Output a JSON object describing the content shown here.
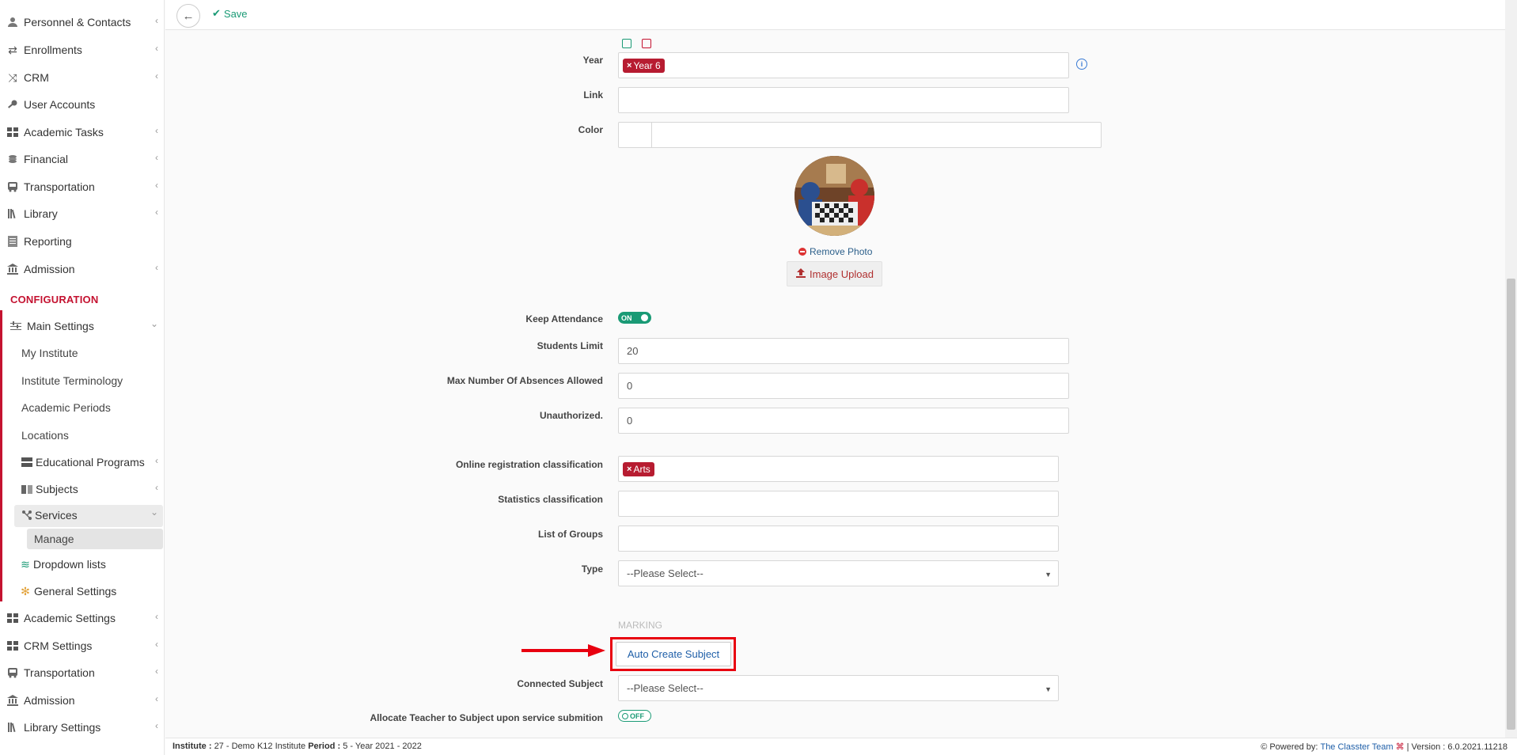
{
  "sidebar": {
    "items": [
      {
        "label": "Personnel & Contacts",
        "icon": "person-icon",
        "chevron": true
      },
      {
        "label": "Enrollments",
        "icon": "exchange-icon",
        "chevron": true
      },
      {
        "label": "CRM",
        "icon": "shuffle-icon",
        "chevron": true
      },
      {
        "label": "User Accounts",
        "icon": "key-icon",
        "chevron": false
      },
      {
        "label": "Academic Tasks",
        "icon": "grid-icon",
        "chevron": true
      },
      {
        "label": "Financial",
        "icon": "coins-icon",
        "chevron": true
      },
      {
        "label": "Transportation",
        "icon": "bus-icon",
        "chevron": true
      },
      {
        "label": "Library",
        "icon": "books-icon",
        "chevron": true
      },
      {
        "label": "Reporting",
        "icon": "report-icon",
        "chevron": false
      },
      {
        "label": "Admission",
        "icon": "bank-icon",
        "chevron": true
      }
    ],
    "config_heading": "CONFIGURATION",
    "main_settings": "Main Settings",
    "sub_items": [
      "My Institute",
      "Institute Terminology",
      "Academic Periods",
      "Locations"
    ],
    "educational_programs": "Educational Programs",
    "subjects": "Subjects",
    "services": "Services",
    "manage": "Manage",
    "dropdown_lists": "Dropdown lists",
    "general_settings": "General Settings",
    "bottom_items": [
      {
        "label": "Academic Settings",
        "icon": "grid-icon"
      },
      {
        "label": "CRM Settings",
        "icon": "grid-icon"
      },
      {
        "label": "Transportation",
        "icon": "bus-icon"
      },
      {
        "label": "Admission",
        "icon": "bank-icon"
      },
      {
        "label": "Library Settings",
        "icon": "books-icon"
      }
    ]
  },
  "toolbar": {
    "save_label": "Save"
  },
  "form": {
    "year_label": "Year",
    "year_tag": "Year 6",
    "link_label": "Link",
    "color_label": "Color",
    "remove_photo": "Remove Photo",
    "image_upload": "Image Upload",
    "keep_attendance_label": "Keep Attendance",
    "keep_attendance_state": "ON",
    "students_limit_label": "Students Limit",
    "students_limit_value": "20",
    "max_absences_label": "Max Number Of Absences Allowed",
    "max_absences_value": "0",
    "unauthorized_label": "Unauthorized.",
    "unauthorized_value": "0",
    "online_reg_label": "Online registration classification",
    "online_reg_tag": "Arts",
    "statistics_label": "Statistics classification",
    "groups_label": "List of Groups",
    "type_label": "Type",
    "type_value": "--Please Select--",
    "marking_heading": "MARKING",
    "auto_create_subject": "Auto Create Subject",
    "connected_subject_label": "Connected Subject",
    "connected_subject_value": "--Please Select--",
    "allocate_teacher_label": "Allocate Teacher to Subject upon service submition",
    "allocate_teacher_state": "OFF"
  },
  "footer": {
    "institute_label": "Institute :",
    "institute_value": "27 - Demo K12 Institute",
    "period_label": "Period :",
    "period_value": "5 - Year 2021 - 2022",
    "powered_label": "Powered by:",
    "powered_link": "The Classter Team",
    "version": "| Version : 6.0.2021.11218"
  },
  "colors": {
    "accent_red": "#c41230",
    "accent_green": "#1a9a75",
    "highlight": "#e8000f"
  }
}
